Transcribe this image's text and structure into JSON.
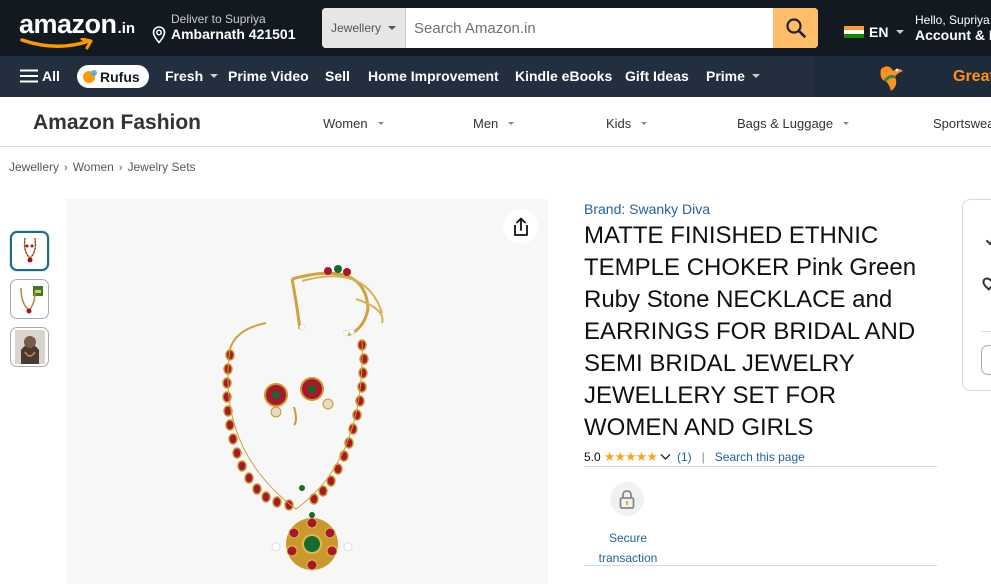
{
  "header": {
    "logo": "amazon",
    "logo_tld": ".in",
    "deliver_line1": "Deliver to Supriya",
    "deliver_line2": "Ambarnath 421501",
    "search_category": "Jewellery",
    "search_placeholder": "Search Amazon.in",
    "language": "EN",
    "account_line1": "Hello, Supriya",
    "account_line2": "Account & L"
  },
  "nav": {
    "all": "All",
    "rufus": "Rufus",
    "items": [
      "Fresh",
      "Prime Video",
      "Sell",
      "Home Improvement",
      "Kindle eBooks",
      "Gift Ideas",
      "Prime"
    ],
    "promo": "Great"
  },
  "fashion": {
    "brand": "Amazon Fashion",
    "categories": [
      "Women",
      "Men",
      "Kids",
      "Bags & Luggage",
      "Sportswear"
    ]
  },
  "breadcrumb": [
    "Jewellery",
    "Women",
    "Jewelry Sets"
  ],
  "product": {
    "brand_link": "Brand: Swanky Diva",
    "title": "MATTE FINISHED ETHNIC TEMPLE CHOKER Pink Green Ruby Stone NECKLACE and EARRINGS FOR BRIDAL AND SEMI BRIDAL JEWELRY JEWELLERY SET FOR WOMEN AND GIRLS",
    "rating_value": "5.0",
    "rating_stars": "★★★★★",
    "rating_count": "(1)",
    "search_this_page": "Search this page",
    "secure_label": "Secure transaction"
  },
  "icons": [
    "share-icon",
    "search-icon",
    "lock-icon",
    "location-pin-icon",
    "hamburger-icon"
  ],
  "colors": {
    "topbar": "#131921",
    "navbar": "#232f3e",
    "search_button": "#febd69",
    "link": "#2162a1",
    "star": "#f7a723",
    "promo": "#ff8f1f"
  }
}
